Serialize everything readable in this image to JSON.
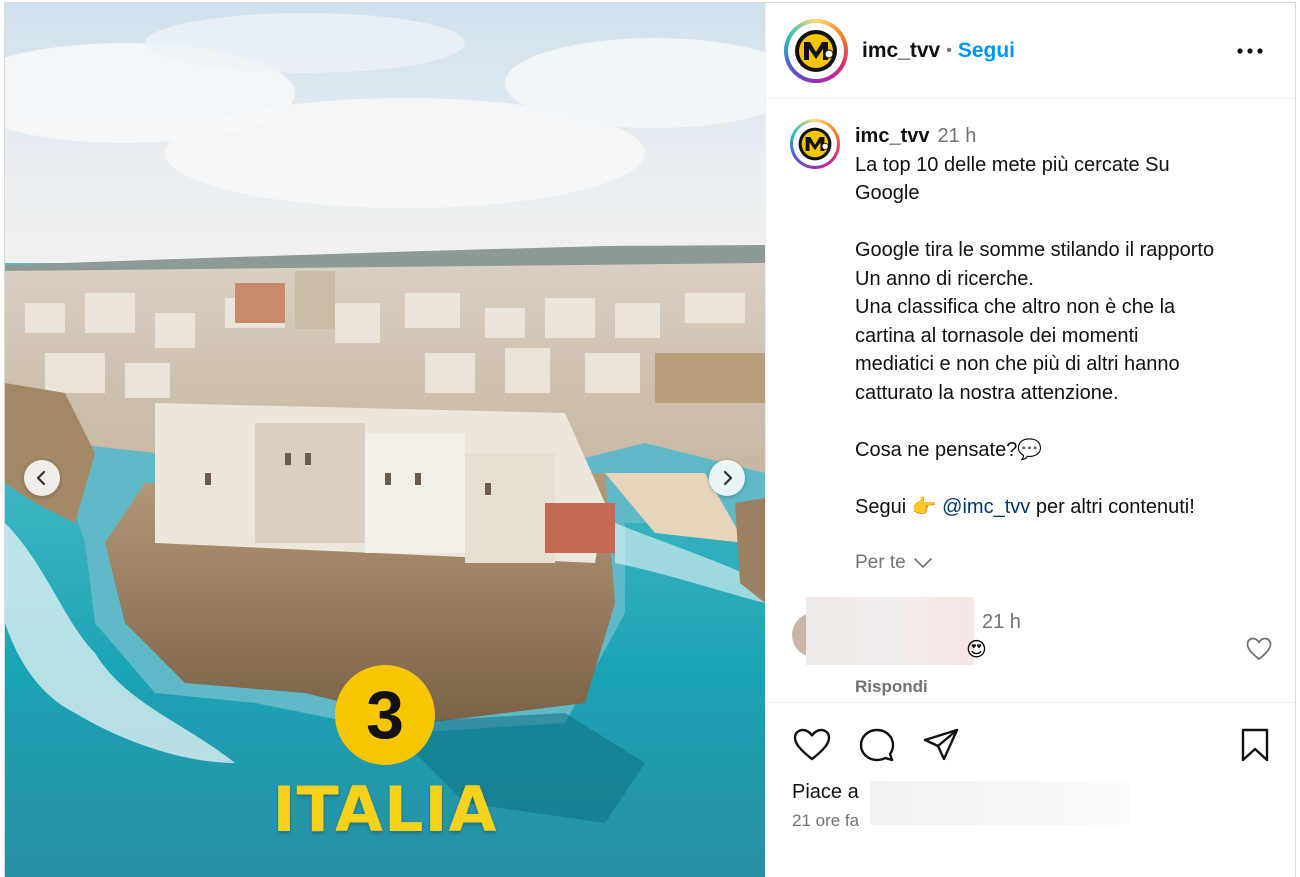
{
  "post": {
    "image": {
      "badge_number": "3",
      "country": "ITALIA"
    },
    "header": {
      "username": "imc_tvv",
      "separator": "•",
      "follow_label": "Segui",
      "more_icon": "more-horizontal-icon"
    },
    "caption": {
      "username": "imc_tvv",
      "time": "21 h",
      "lines": [
        "La top 10 delle mete più cercate Su",
        "Google",
        "",
        "Google tira le somme stilando il rapporto",
        "Un anno di ricerche.",
        "Una classifica che altro non è che la",
        "cartina al tornasole dei momenti",
        "mediatici e non che più di altri hanno",
        "catturato la nostra attenzione.",
        "",
        "Cosa ne pensate?💬",
        ""
      ],
      "follow_prefix": "Segui 👉 ",
      "mention": "@imc_tvv",
      "follow_suffix": " per altri contenuti!",
      "translation_label": "Per te"
    },
    "comment": {
      "time": "21 h",
      "emoji": "😍",
      "reply_label": "Rispondi"
    },
    "footer": {
      "likes_prefix": "Piace a",
      "time_ago": "21 ore fa"
    },
    "colors": {
      "accent": "#0095f6",
      "mention": "#00376b",
      "secondary_text": "#737373",
      "badge": "#f7c600",
      "country_text": "#f7d21a"
    }
  }
}
